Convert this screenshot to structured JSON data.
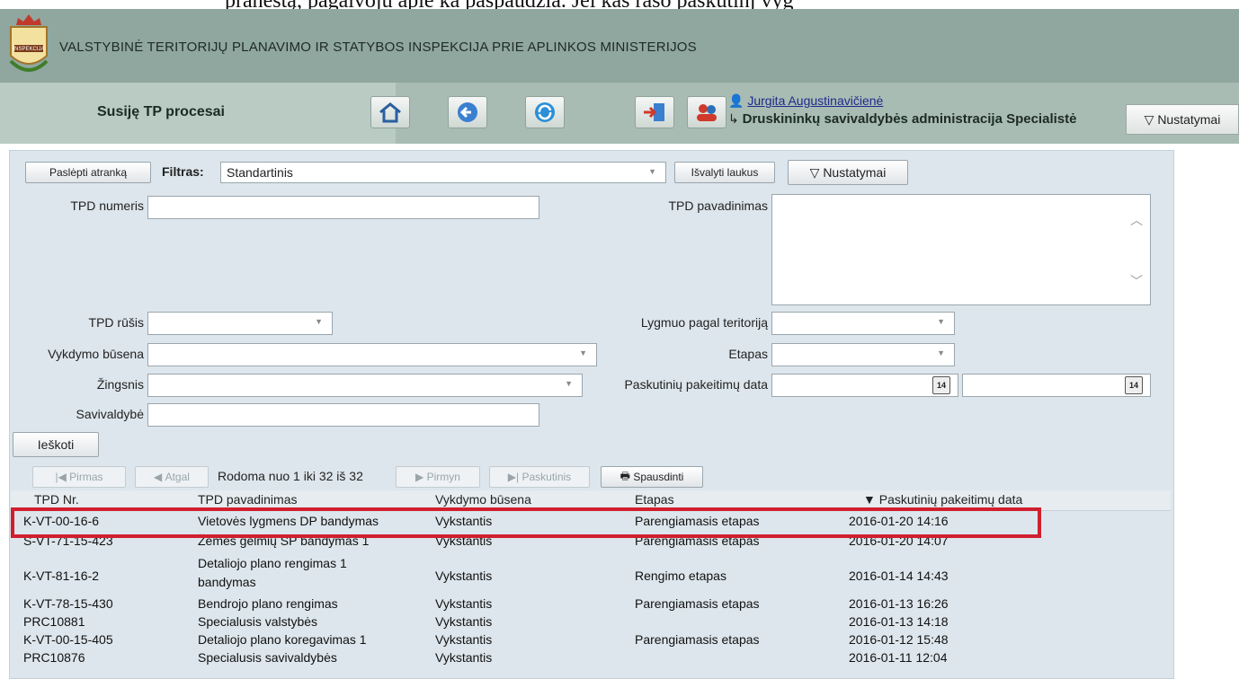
{
  "cropped_top_text": "praneštą, pagalvoju apie ka paspaudžia. Jei kas rašo paskutinj vyg",
  "header": {
    "title": "VALSTYBINĖ TERITORIJŲ PLANAVIMO IR STATYBOS INSPEKCIJA PRIE APLINKOS MINISTERIJOS",
    "logo_text": "INSPEKCIJA"
  },
  "nav": {
    "page_title": "Susiję TP procesai",
    "user_name": "Jurgita Augustinavičienė",
    "user_org": "Druskininkų savivaldybės administracija Specialistė",
    "settings_label": "▽ Nustatymai"
  },
  "filter": {
    "hide_button": "Paslėpti atranką",
    "filter_label": "Filtras:",
    "filter_value": "Standartinis",
    "clear_button": "Išvalyti laukus",
    "settings_button": "▽ Nustatymai",
    "labels": {
      "tpd_numeris": "TPD numeris",
      "tpd_pavadinimas": "TPD pavadinimas",
      "tpd_rusis": "TPD rūšis",
      "lygmuo": "Lygmuo pagal teritoriją",
      "vykdymo_busena": "Vykdymo būsena",
      "etapas": "Etapas",
      "zingsnis": "Žingsnis",
      "paskutiniu_data": "Paskutinių pakeitimų data",
      "savivaldybe": "Savivaldybė"
    },
    "calendar_label": "14",
    "search_button": "Ieškoti"
  },
  "pager": {
    "first": "Pirmas",
    "prev": "Atgal",
    "info": "Rodoma nuo 1 iki 32 iš 32",
    "next": "Pirmyn",
    "last": "Paskutinis",
    "print": "Spausdinti"
  },
  "table": {
    "columns": [
      "TPD Nr.",
      "TPD pavadinimas",
      "Vykdymo būsena",
      "Etapas",
      "▼ Paskutinių pakeitimų data"
    ],
    "rows": [
      {
        "nr": "K-VT-00-16-6",
        "name": "Vietovės lygmens DP bandymas",
        "status": "Vykstantis",
        "stage": "Parengiamasis etapas",
        "date": "2016-01-20 14:16"
      },
      {
        "nr": "S-VT-71-15-423",
        "name": "Žemės gelmių SP bandymas 1",
        "status": "Vykstantis",
        "stage": "Parengiamasis etapas",
        "date": "2016-01-20 14:07"
      },
      {
        "nr": "K-VT-81-16-2",
        "name": "Detaliojo plano rengimas 1",
        "name2": "bandymas",
        "status": "Vykstantis",
        "stage": "Rengimo etapas",
        "date": "2016-01-14 14:43"
      },
      {
        "nr": "K-VT-78-15-430",
        "name": "Bendrojo plano rengimas",
        "status": "Vykstantis",
        "stage": "Parengiamasis etapas",
        "date": "2016-01-13 16:26"
      },
      {
        "nr": "PRC10881",
        "name": "Specialusis valstybės",
        "status": "Vykstantis",
        "stage": "",
        "date": "2016-01-13 14:18"
      },
      {
        "nr": "K-VT-00-15-405",
        "name": "Detaliojo plano koregavimas 1",
        "status": "Vykstantis",
        "stage": "Parengiamasis etapas",
        "date": "2016-01-12 15:48"
      },
      {
        "nr": "PRC10876",
        "name": "Specialusis savivaldybės",
        "status": "Vykstantis",
        "stage": "",
        "date": "2016-01-11 12:04"
      }
    ]
  }
}
